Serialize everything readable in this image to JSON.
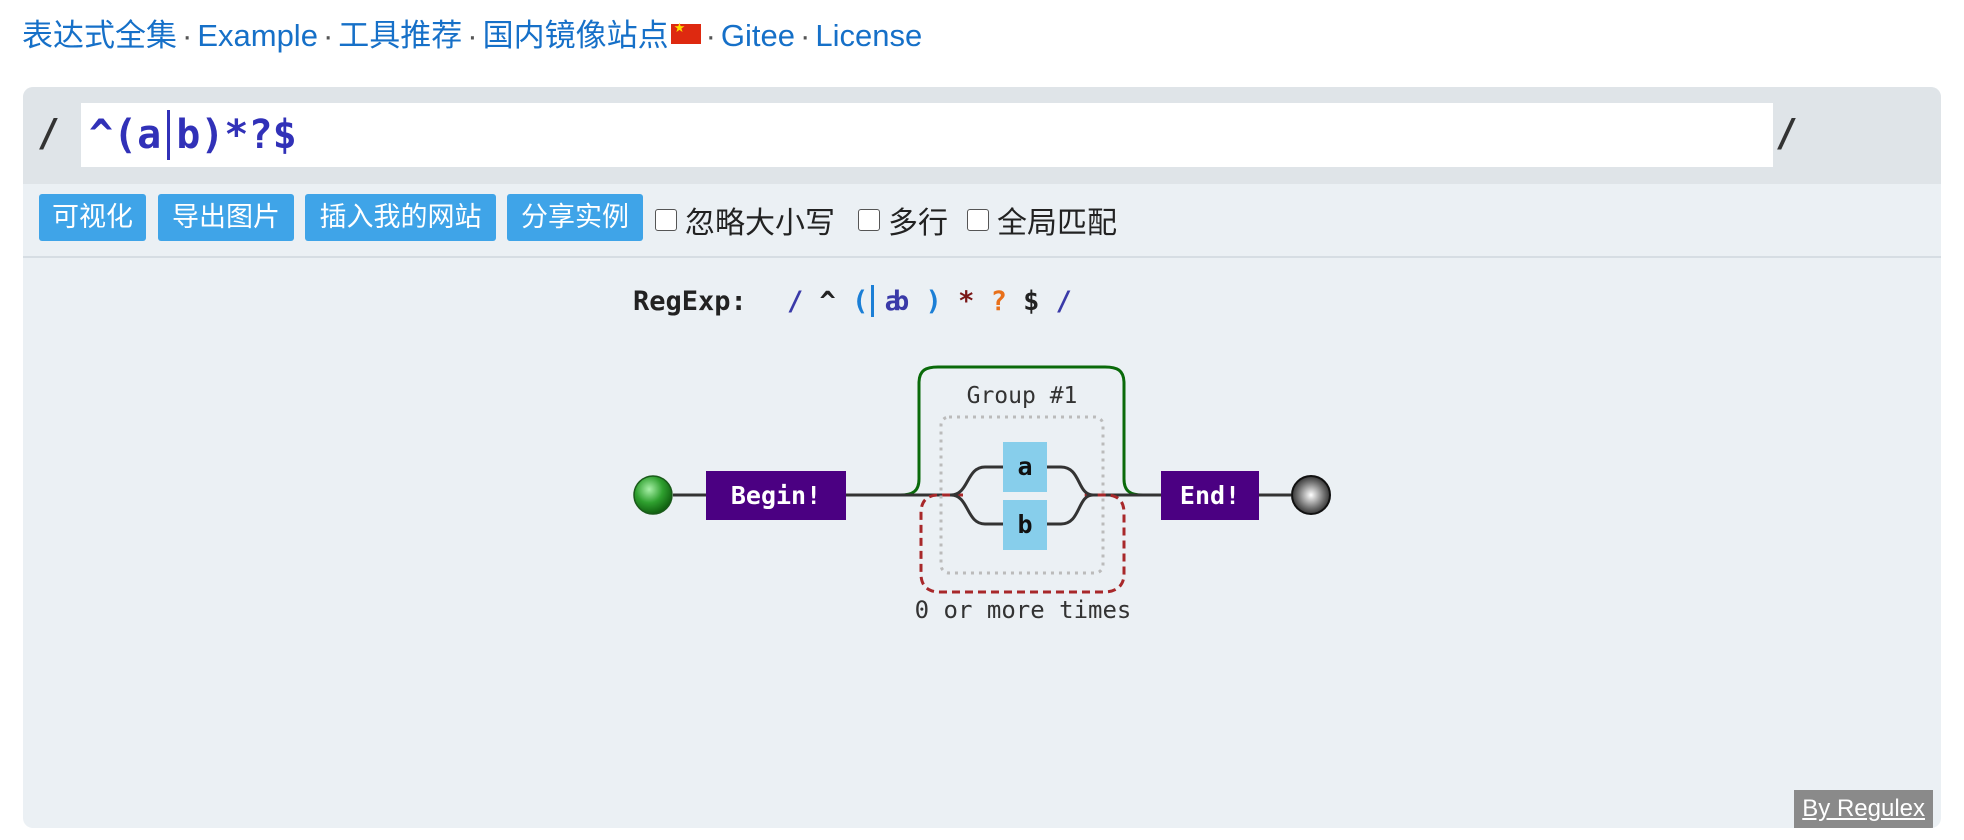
{
  "nav": {
    "links": [
      "表达式全集",
      "Example",
      "工具推荐",
      "国内镜像站点",
      "Gitee",
      "License"
    ],
    "separator": "·",
    "flag_icon": "china-flag-icon"
  },
  "regex": {
    "open_slash": "/",
    "close_slash": "/",
    "value": "^(a|b)*?$",
    "part1": "^(a",
    "part2": "b)*?$"
  },
  "toolbar": {
    "visualize": "可视化",
    "export_image": "导出图片",
    "embed": "插入我的网站",
    "share": "分享实例",
    "ignore_case": "忽略大小写",
    "multiline": "多行",
    "global": "全局匹配"
  },
  "diagram": {
    "label": "RegExp:",
    "tokens": {
      "slash_open": "/",
      "caret": "^",
      "paren_open": "(",
      "a": "a",
      "b": "b",
      "paren_close": ")",
      "star": "*",
      "question": "?",
      "dollar": "$",
      "slash_close": "/"
    },
    "begin": "Begin!",
    "end": "End!",
    "group": "Group #1",
    "branch_a": "a",
    "branch_b": "b",
    "repeat": "0 or more times"
  },
  "footer": {
    "credit": "By Regulex"
  },
  "colors": {
    "link": "#1670c8",
    "button": "#3fa4e8",
    "anchor_node": "#4b0082",
    "literal_node": "#87ceeb",
    "group_border": "#0a6a0a",
    "repeat_border": "#a8282a",
    "regex_text": "#3131b8"
  }
}
